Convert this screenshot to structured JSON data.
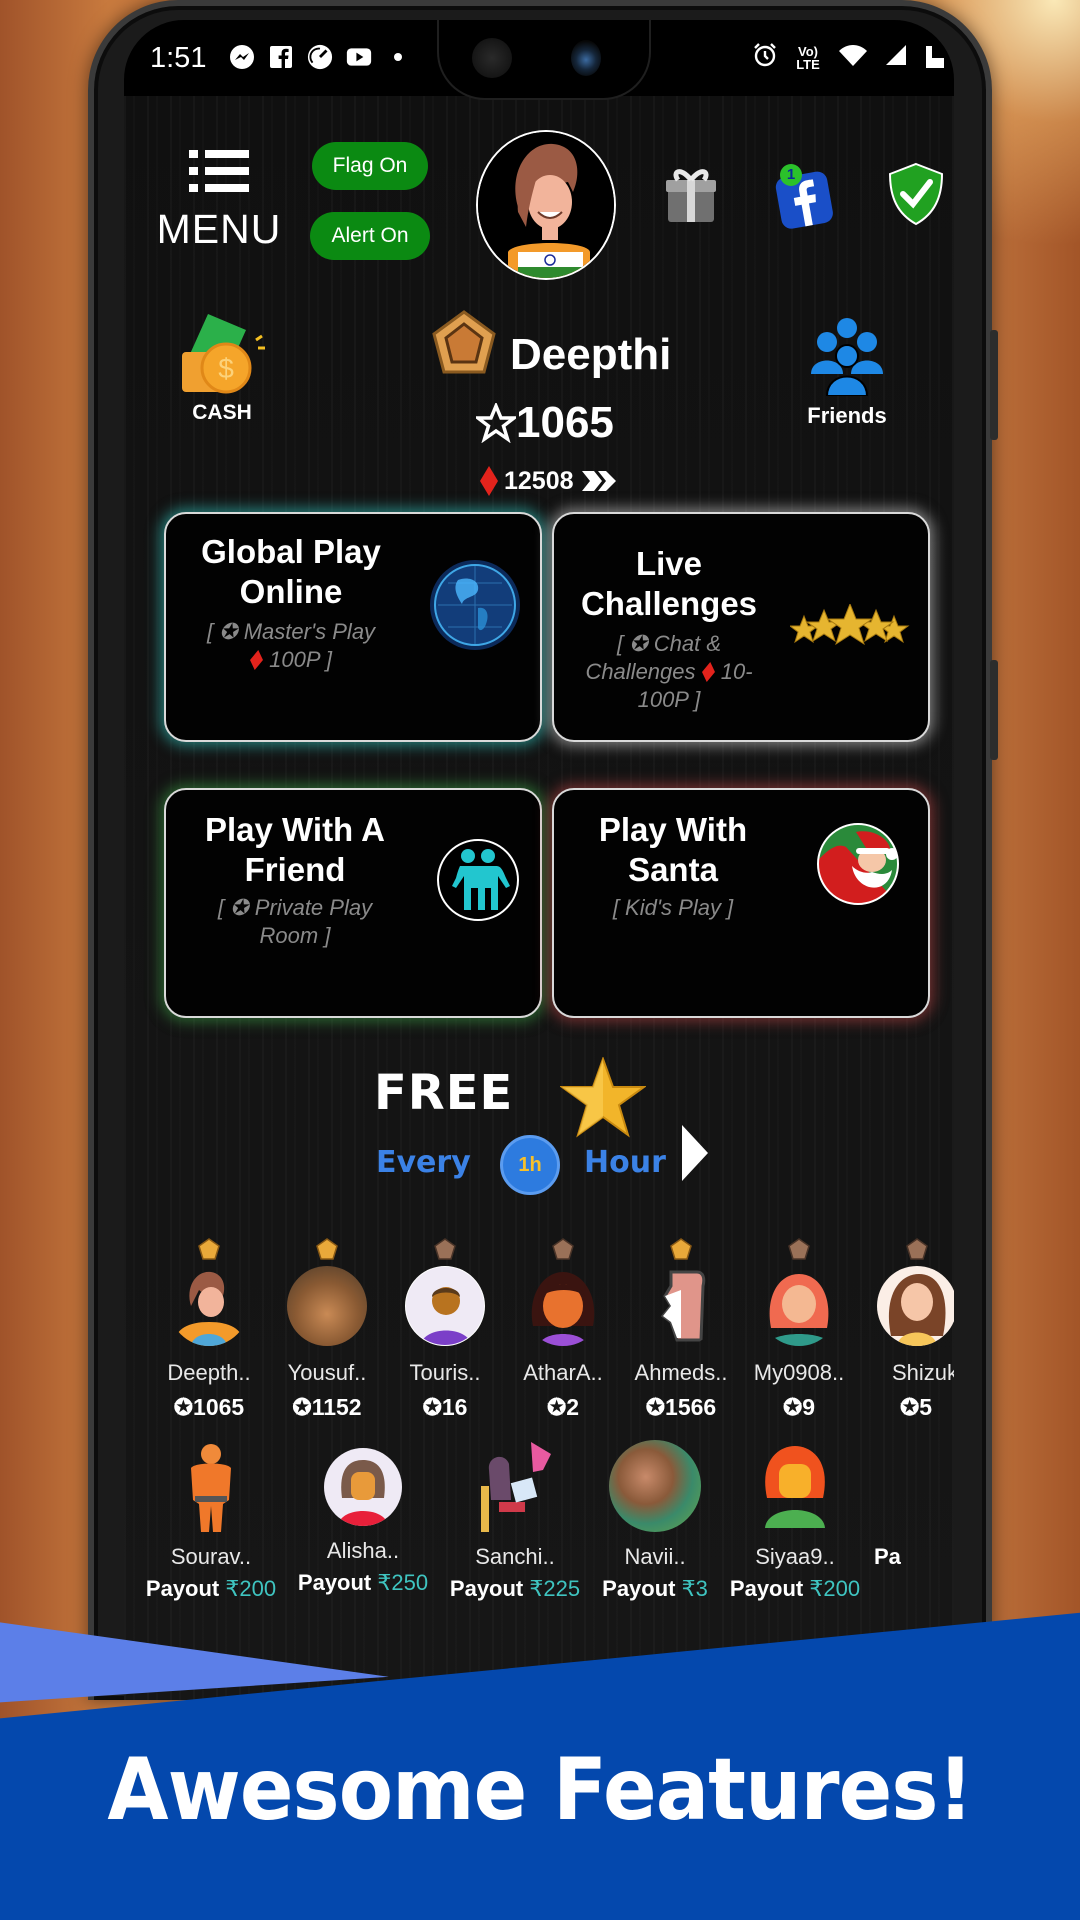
{
  "status_bar": {
    "time": "1:51",
    "left_icons": [
      "messenger-icon",
      "facebook-icon",
      "speedometer-icon",
      "youtube-icon",
      "dot-icon"
    ],
    "right_icons": [
      "alarm-icon",
      "volte-lte-icon",
      "wifi-icon",
      "signal-icon",
      "battery-icon"
    ],
    "volte_label": "Vo) LTE"
  },
  "header": {
    "menu_label": "MENU",
    "flag_toggle": "Flag On",
    "alert_toggle": "Alert On",
    "facebook_badge_count": "1",
    "icons": [
      "gift-icon",
      "facebook-icon",
      "shield-check-icon"
    ]
  },
  "profile": {
    "cash_label": "CASH",
    "friends_label": "Friends",
    "name": "Deepthi",
    "stars": "1065",
    "diamonds": "12508",
    "country_flag": "India"
  },
  "cards": [
    {
      "title": "Global Play Online",
      "title_lines": [
        "Global Play",
        "Online"
      ],
      "subtitle_lines": [
        "[ ✪ Master's Play",
        "100P ]"
      ],
      "icon": "globe-icon",
      "glow": "#35d0c8"
    },
    {
      "title": "Live Challenges",
      "title_lines": [
        "Live",
        "Challenges"
      ],
      "subtitle_lines": [
        "[ ✪ Chat &",
        "Challenges",
        "10-",
        "100P ]"
      ],
      "icon": "five-stars-icon",
      "glow": "#e0e0e0"
    },
    {
      "title": "Play With A Friend",
      "title_lines": [
        "Play With A",
        "Friend"
      ],
      "subtitle_lines": [
        "[ ✪ Private Play",
        "Room ]"
      ],
      "icon": "two-people-icon",
      "glow": "#3fae4a"
    },
    {
      "title": "Play With Santa",
      "title_lines": [
        "Play With",
        "Santa"
      ],
      "subtitle_lines": [
        "[ Kid's Play ]"
      ],
      "icon": "santa-icon",
      "glow": "#c94a4a"
    }
  ],
  "free_star": {
    "free": "FREE",
    "every": "Every",
    "badge": "1h",
    "hour": "Hour"
  },
  "leaderboard": [
    {
      "name": "Deepth..",
      "stars": "1065",
      "rank": "gold"
    },
    {
      "name": "Yousuf..",
      "stars": "1152",
      "rank": "gold"
    },
    {
      "name": "Touris..",
      "stars": "16",
      "rank": "bronze"
    },
    {
      "name": "AtharA..",
      "stars": "2",
      "rank": "bronze"
    },
    {
      "name": "Ahmeds..",
      "stars": "1566",
      "rank": "gold"
    },
    {
      "name": "My0908..",
      "stars": "9",
      "rank": "bronze"
    },
    {
      "name": "Shizuk",
      "stars": "5",
      "rank": "bronze"
    }
  ],
  "payouts": [
    {
      "name": "Sourav..",
      "label": "Payout",
      "amount": "₹200"
    },
    {
      "name": "Alisha..",
      "label": "Payout",
      "amount": "₹250"
    },
    {
      "name": "Sanchi..",
      "label": "Payout",
      "amount": "₹225"
    },
    {
      "name": "Navii..",
      "label": "Payout",
      "amount": "₹3"
    },
    {
      "name": "Siyaa9..",
      "label": "Payout",
      "amount": "₹200"
    },
    {
      "name": "",
      "label": "Pa",
      "amount": ""
    }
  ],
  "banner": {
    "headline": "Awesome Features!"
  },
  "colors": {
    "toggle_green": "#0b8a12",
    "payout_teal": "#3fc4c0",
    "banner_blue": "#0448ad",
    "banner_light_blue": "#5c7fe8",
    "diamond_red": "#e3231c"
  }
}
